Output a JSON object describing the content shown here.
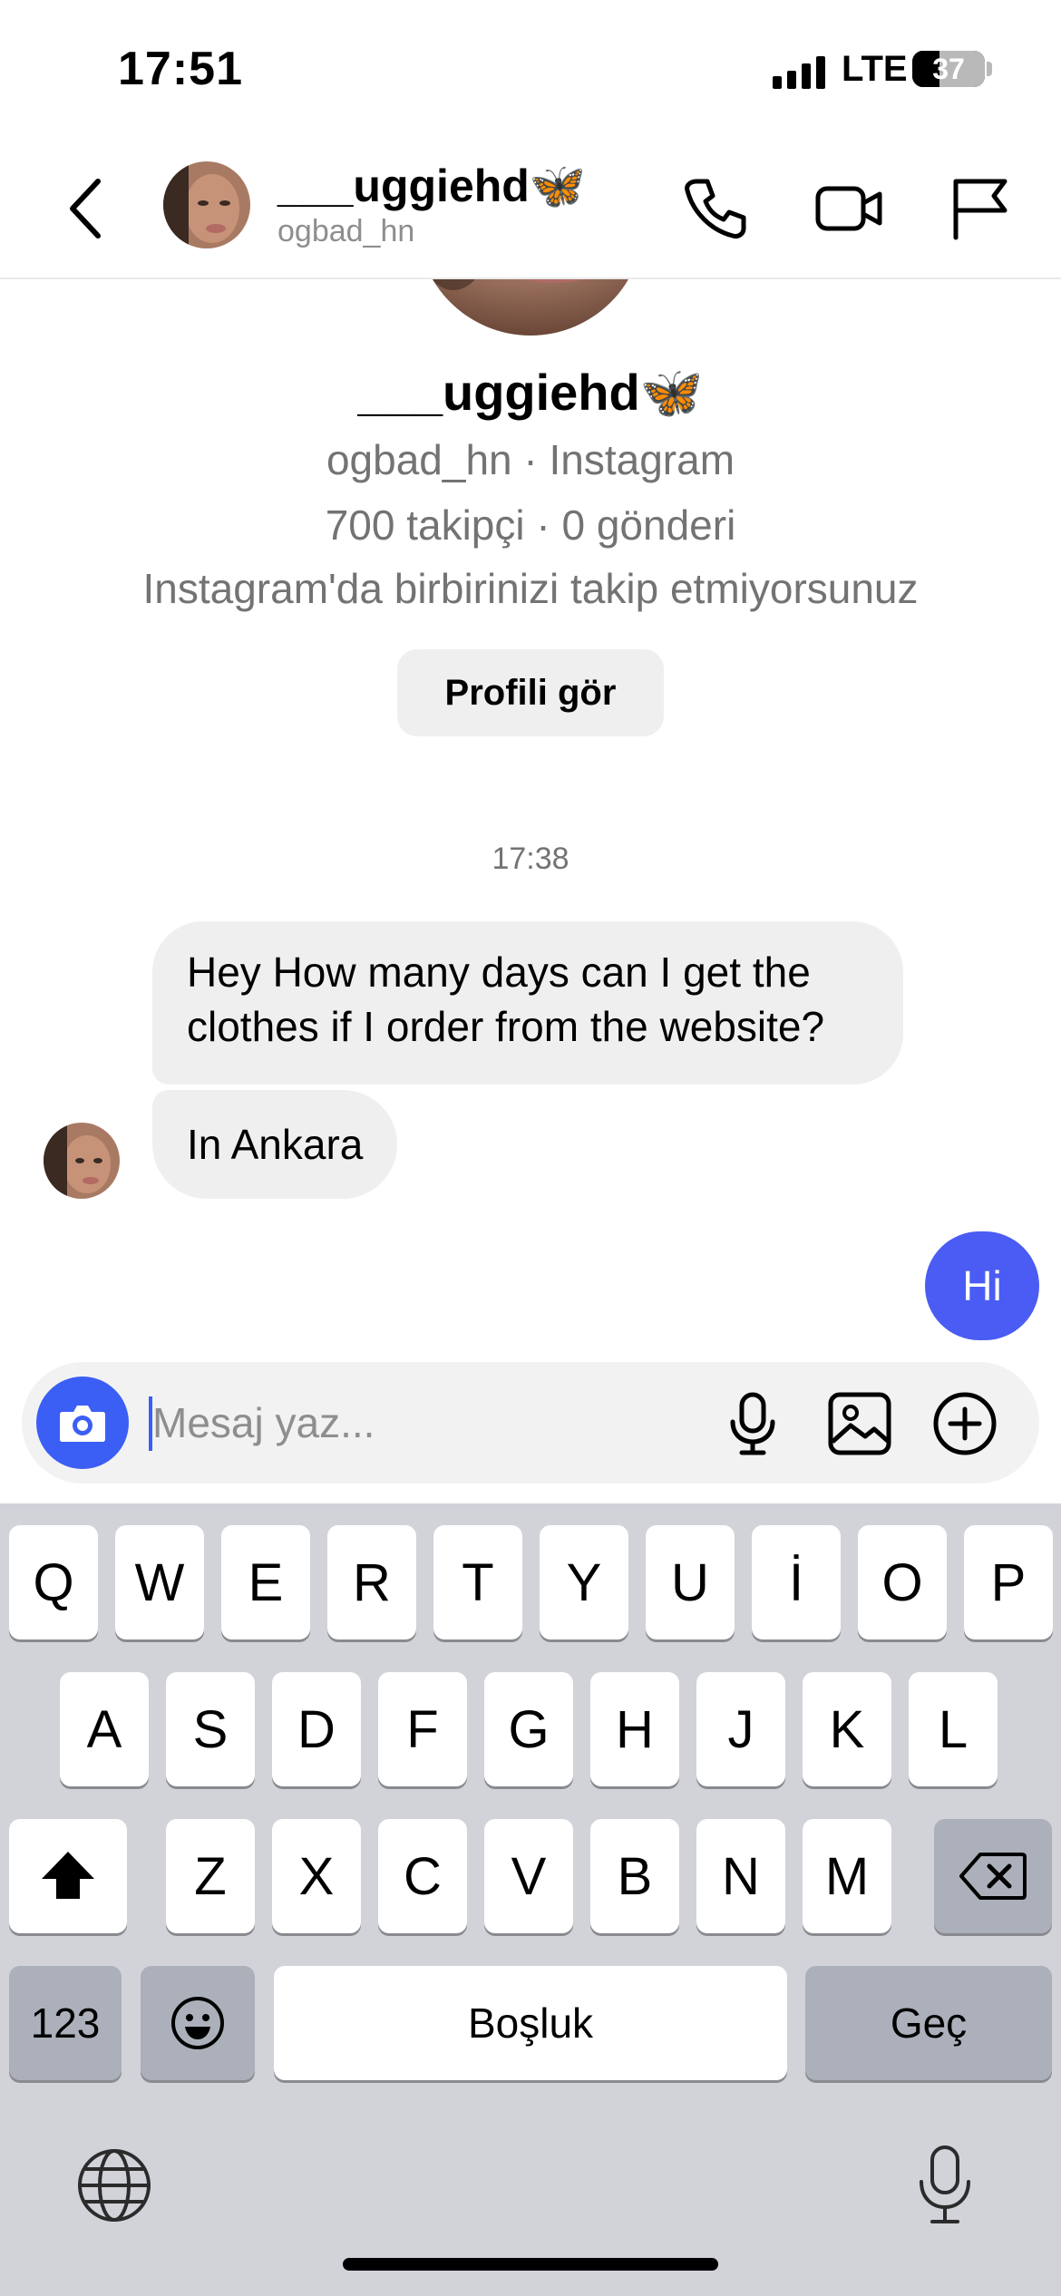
{
  "status_bar": {
    "time": "17:51",
    "network": "LTE",
    "battery": "37",
    "battery_level": 0.37
  },
  "header": {
    "name": "___uggiehd🦋",
    "username": "ogbad_hn",
    "icons": [
      "back-chevron-icon",
      "phone-icon",
      "video-camera-icon",
      "flag-icon"
    ]
  },
  "profile": {
    "name": "___uggiehd🦋",
    "handle_line": "ogbad_hn · Instagram",
    "stats_line": "700 takipçi · 0 gönderi",
    "follow_note": "Instagram'da birbirinizi takip etmiyorsunuz",
    "view_profile_label": "Profili gör"
  },
  "conversation": {
    "timestamp": "17:38",
    "messages": [
      {
        "from": "them",
        "text": "Hey How many days can I get the clothes if I order from the website?"
      },
      {
        "from": "them",
        "text": "In Ankara"
      },
      {
        "from": "me",
        "text": "Hi"
      }
    ]
  },
  "composer": {
    "placeholder": "Mesaj yaz...",
    "value": "",
    "icons": [
      "camera-icon",
      "microphone-icon",
      "image-icon",
      "plus-circle-icon"
    ]
  },
  "keyboard": {
    "row1": [
      "Q",
      "W",
      "E",
      "R",
      "T",
      "Y",
      "U",
      "İ",
      "O",
      "P"
    ],
    "row2": [
      "A",
      "S",
      "D",
      "F",
      "G",
      "H",
      "J",
      "K",
      "L"
    ],
    "row3": [
      "Z",
      "X",
      "C",
      "V",
      "B",
      "N",
      "M"
    ],
    "numbers_key": "123",
    "space_key": "Boşluk",
    "return_key": "Geç",
    "icons": [
      "shift-icon",
      "backspace-icon",
      "emoji-icon",
      "globe-icon",
      "dictation-mic-icon"
    ]
  },
  "colors": {
    "accent": "#3b5ef5",
    "outgoing_bubble": "#4a5cf3",
    "incoming_bubble": "#efefef",
    "keyboard_bg": "#d1d3d9"
  }
}
